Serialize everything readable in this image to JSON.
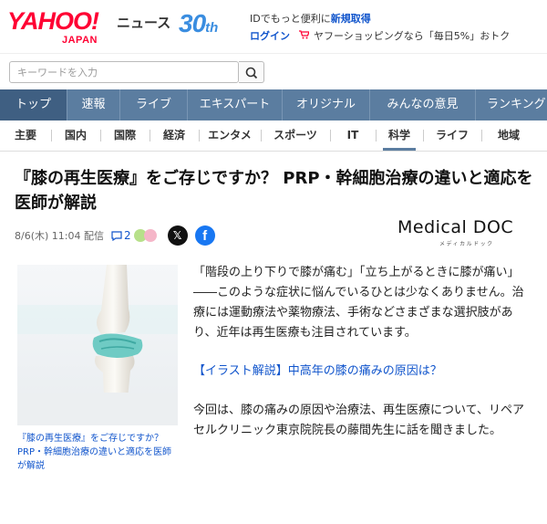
{
  "header": {
    "logo_text": "YAHOO!",
    "logo_sub": "JAPAN",
    "service": "ニュース",
    "anniversary_num": "30",
    "anniversary_suffix": "th",
    "id_prefix": "IDでもっと便利に",
    "id_link": "新規取得",
    "login": "ログイン",
    "promo": "ヤフーショッピングなら「毎日5%」おトク"
  },
  "search": {
    "placeholder": "キーワードを入力"
  },
  "main_nav": [
    "トップ",
    "速報",
    "ライブ",
    "エキスパート",
    "オリジナル",
    "みんなの意見",
    "ランキング"
  ],
  "sub_nav": [
    "主要",
    "国内",
    "国際",
    "経済",
    "エンタメ",
    "スポーツ",
    "IT",
    "科学",
    "ライフ",
    "地域"
  ],
  "article": {
    "title": "『膝の再生医療』をご存じですか？ PRP・幹細胞治療の違いと適応を医師が解説",
    "date": "8/6(木) 11:04 配信",
    "comment_count": "2",
    "provider_name": "Medical DOC",
    "provider_sub": "メディカルドック",
    "image_caption": "『膝の再生医療』をご存じですか？ PRP・幹細胞治療の違いと適応を医師が解説",
    "paragraph1": "「階段の上り下りで膝が痛む」「立ち上がるときに膝が痛い」――このような症状に悩んでいるひとは少なくありません。治療には運動療法や薬物療法、手術などさまざまな選択肢があり、近年は再生医療も注目されています。",
    "link_text": "【イラスト解説】中高年の膝の痛みの原因は？",
    "paragraph2": "今回は、膝の痛みの原因や治療法、再生医療について、リペアセルクリニック東京院院長の藤間先生に話を聞きました。"
  },
  "colors": {
    "brand_red": "#ff0033",
    "nav_blue": "#5b7da0",
    "link_blue": "#1155cc",
    "anniversary_blue": "#3a8de0",
    "facebook_blue": "#1877f2"
  },
  "icons": [
    "search-icon",
    "cart-icon",
    "comment-icon",
    "x-share-icon",
    "facebook-share-icon"
  ]
}
